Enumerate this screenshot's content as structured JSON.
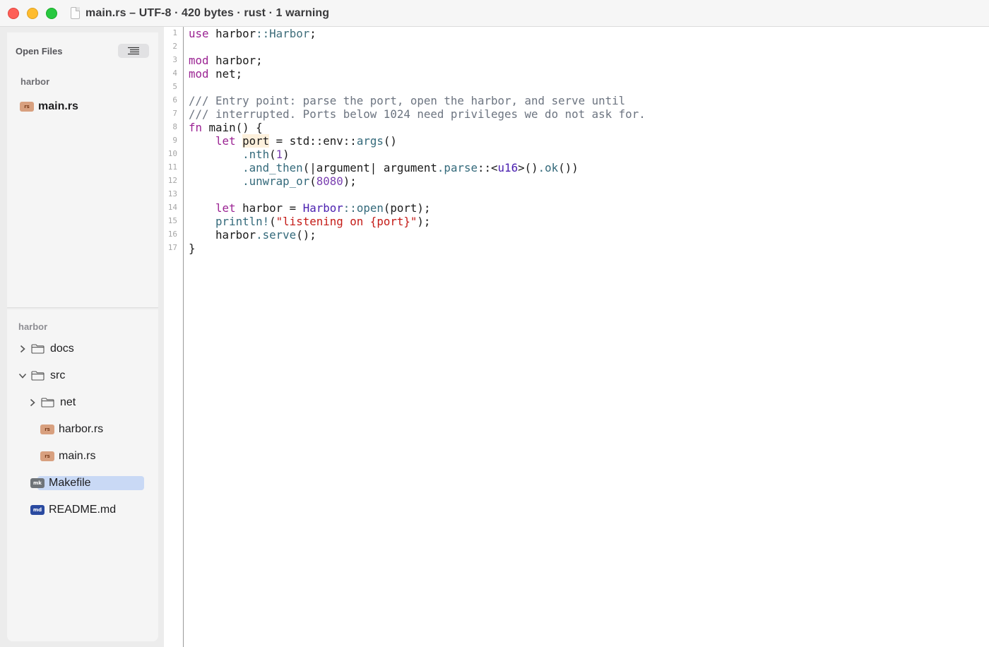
{
  "window": {
    "title": "main.rs – UTF-8 · 420 bytes · rust · 1 warning"
  },
  "sidebar": {
    "open_files_label": "Open Files",
    "open_group": "harbor",
    "open_files": [
      {
        "badge": "rs",
        "name": "main.rs"
      }
    ],
    "project_label": "harbor",
    "tree": {
      "docs": "docs",
      "src": "src",
      "net": "net",
      "harbor_rs": "harbor.rs",
      "main_rs": "main.rs",
      "makefile": "Makefile",
      "readme": "README.md",
      "badge_rs": "rs",
      "badge_mk": "mk",
      "badge_md": "md"
    }
  },
  "editor": {
    "line_numbers": [
      "1",
      "2",
      "3",
      "4",
      "5",
      "6",
      "7",
      "8",
      "9",
      "10",
      "11",
      "12",
      "13",
      "14",
      "15",
      "16",
      "17"
    ],
    "tokens": {
      "use": "use",
      "harbor": "harbor",
      "sep": "::",
      "Harbor": "Harbor",
      "semi": ";",
      "mod": "mod",
      "net": "net",
      "comment1": "/// Entry point: parse the port, open the harbor, and serve until",
      "comment2": "/// interrupted. Ports below 1024 need privileges we do not ask for.",
      "fn": "fn",
      "main_sig": "main() {",
      "let": "let",
      "port": "port",
      "eq_std": "= std::env::",
      "args": "args",
      "parens": "()",
      "nth": ".nth",
      "one": "1",
      "and_then": ".and_then",
      "closure": "(|argument| argument",
      "parse": ".parse",
      "turbofish_open": "::<",
      "u16": "u16",
      "turbofish_close": ">()",
      "ok": ".ok",
      "close2": "())",
      "unwrap_or": ".unwrap_or",
      "num8080": "8080",
      "close_semi": ");",
      "harbor_eq": "harbor = ",
      "open": "open",
      "port_arg": "(port);",
      "println": "println!",
      "str_lit": "\"listening on {port}\"",
      "serve": ".serve",
      "serve_end": "();",
      "brace": "}"
    }
  },
  "colors": {
    "selection": "#c9d9f5",
    "keyword": "#9b2393",
    "string": "#c41a16",
    "comment": "#6c7480"
  }
}
